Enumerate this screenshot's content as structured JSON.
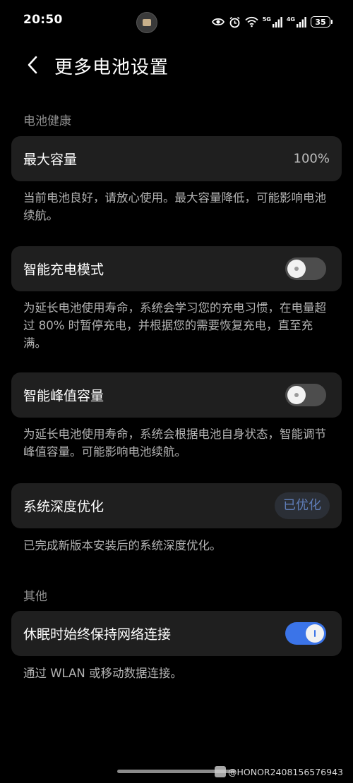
{
  "status_bar": {
    "time": "20:50",
    "net1": "5G",
    "net2": "4G",
    "battery": "35",
    "icons": [
      "eye-icon",
      "alarm-icon",
      "wifi-icon",
      "signal-5g-icon",
      "signal-4g-icon",
      "battery-icon"
    ]
  },
  "header": {
    "title": "更多电池设置",
    "back_icon": "chevron-left-icon"
  },
  "sections": {
    "battery_health": {
      "label": "电池健康",
      "max_capacity": {
        "label": "最大容量",
        "value": "100%",
        "desc": "当前电池良好，请放心使用。最大容量降低，可能影响电池续航。"
      },
      "smart_charge": {
        "label": "智能充电模式",
        "enabled": false,
        "desc": "为延长电池使用寿命，系统会学习您的充电习惯，在电量超过 80% 时暂停充电，并根据您的需要恢复充电，直至充满。"
      },
      "peak_capacity": {
        "label": "智能峰值容量",
        "enabled": false,
        "desc": "为延长电池使用寿命，系统会根据电池自身状态，智能调节峰值容量。可能影响电池续航。"
      },
      "deep_optimize": {
        "label": "系统深度优化",
        "badge": "已优化",
        "desc": "已完成新版本安装后的系统深度优化。"
      }
    },
    "other": {
      "label": "其他",
      "keep_network": {
        "label": "休眠时始终保持网络连接",
        "enabled": true,
        "desc": "通过 WLAN 或移动数据连接。"
      }
    }
  },
  "colors": {
    "background": "#000000",
    "card": "#1f1f1f",
    "toggle_on": "#3b74e8",
    "toggle_off": "#4d4d4d",
    "badge_text": "#5f7db8"
  },
  "watermark": {
    "text": "@HONOR2408156576943"
  }
}
